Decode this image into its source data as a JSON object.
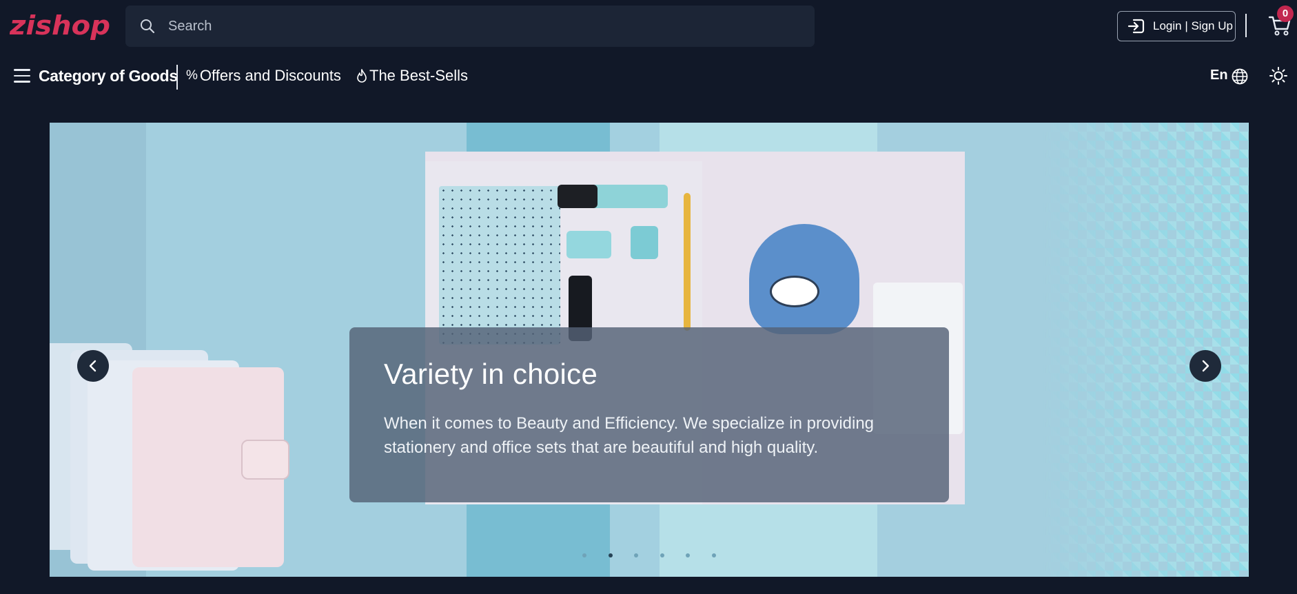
{
  "header": {
    "logo_text": "zishop",
    "search": {
      "placeholder": "Search",
      "value": ""
    },
    "login_label": "Login | Sign Up",
    "cart_count": "0",
    "colors": {
      "brand": "#d8335a",
      "badge": "#c2274f",
      "background": "#111828"
    }
  },
  "nav": {
    "category_label": "Category of Goods",
    "offers_glyph": "%",
    "offers_label": "Offers and Discounts",
    "bestsells_glyph": "🔥",
    "bestsells_label": "The Best-Sells",
    "language_label": "En"
  },
  "hero": {
    "title": "Variety in choice",
    "description": "When it comes to Beauty and Efficiency. We specialize in providing stationery and office sets that are beautiful and high quality.",
    "slide_count": 6,
    "active_slide": 2,
    "icons": [
      "chevron-left-icon",
      "chevron-right-icon"
    ]
  }
}
